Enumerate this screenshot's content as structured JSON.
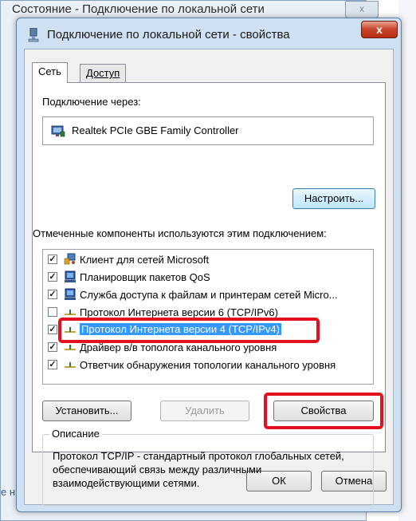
{
  "background_window": {
    "title": "Состояние - Подключение по локальной сети",
    "close_label": "x",
    "side_label": "е н"
  },
  "dialog": {
    "title": "Подключение по локальной сети - свойства",
    "close_label": "x"
  },
  "tabs": [
    {
      "label": "Сеть",
      "active": true
    },
    {
      "label": "Доступ",
      "active": false
    }
  ],
  "connect_via": {
    "label": "Подключение через:",
    "adapter": "Realtek PCIe GBE Family Controller",
    "configure_button": "Настроить..."
  },
  "components": {
    "label": "Отмеченные компоненты используются этим подключением:",
    "items": [
      {
        "label": "Клиент для сетей Microsoft",
        "checked": true,
        "icon": "network-client-icon"
      },
      {
        "label": "Планировщик пакетов QoS",
        "checked": true,
        "icon": "service-icon"
      },
      {
        "label": "Служба доступа к файлам и принтерам сетей Micro...",
        "checked": true,
        "icon": "service-icon"
      },
      {
        "label": "Протокол Интернета версии 6 (TCP/IPv6)",
        "checked": false,
        "icon": "protocol-icon"
      },
      {
        "label": "Протокол Интернета версии 4 (TCP/IPv4)",
        "checked": true,
        "selected": true,
        "icon": "protocol-icon"
      },
      {
        "label": "Драйвер в/в тополога канального уровня",
        "checked": true,
        "icon": "protocol-icon"
      },
      {
        "label": "Ответчик обнаружения топологии канального уровня",
        "checked": true,
        "icon": "protocol-icon"
      }
    ]
  },
  "buttons": {
    "install": "Установить...",
    "remove": "Удалить",
    "properties": "Свойства",
    "ok": "ОК",
    "cancel": "Отмена"
  },
  "description": {
    "title": "Описание",
    "text": "Протокол TCP/IP - стандартный протокол глобальных сетей, обеспечивающий связь между различными взаимодействующими сетями."
  },
  "colors": {
    "highlight": "#e3101d",
    "selection": "#3399ff",
    "close_button": "#c7432a"
  }
}
